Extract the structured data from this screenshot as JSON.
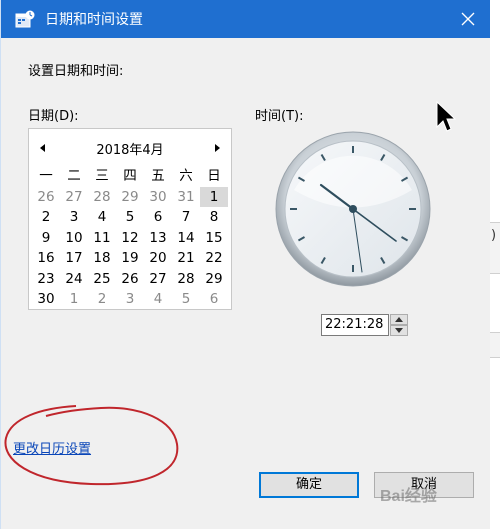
{
  "window": {
    "title": "日期和时间设置",
    "close_icon": "close-icon",
    "heading": "设置日期和时间:"
  },
  "date": {
    "label": "日期(D):",
    "month_title": "2018年4月",
    "weekdays": [
      "一",
      "二",
      "三",
      "四",
      "五",
      "六",
      "日"
    ],
    "weeks": [
      [
        "26",
        "27",
        "28",
        "29",
        "30",
        "31",
        "1"
      ],
      [
        "2",
        "3",
        "4",
        "5",
        "6",
        "7",
        "8"
      ],
      [
        "9",
        "10",
        "11",
        "12",
        "13",
        "14",
        "15"
      ],
      [
        "16",
        "17",
        "18",
        "19",
        "20",
        "21",
        "22"
      ],
      [
        "23",
        "24",
        "25",
        "26",
        "27",
        "28",
        "29"
      ],
      [
        "30",
        "1",
        "2",
        "3",
        "4",
        "5",
        "6"
      ]
    ],
    "selected_day": "1"
  },
  "time": {
    "label": "时间(T):",
    "value": "22:21:28"
  },
  "link": {
    "label": "更改日历设置"
  },
  "buttons": {
    "ok": "确定",
    "cancel": "取消"
  },
  "right_edge_char": ")",
  "watermark": "Bai经验",
  "colors": {
    "titlebar": "#1f6fd0",
    "link": "#0a46b8",
    "annotation": "#c0262c",
    "default_button_border": "#0078d7"
  }
}
